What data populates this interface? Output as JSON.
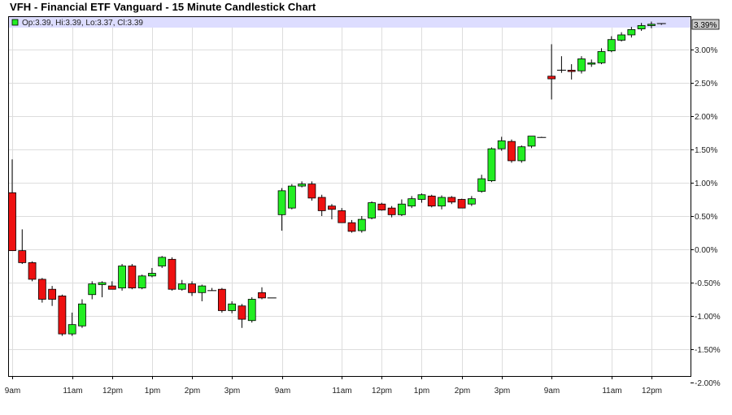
{
  "title": "VFH - Financial ETF Vanguard - 15 Minute Candlestick Chart",
  "legend": "Op:3.39, Hi:3.39, Lo:3.37, Cl:3.39",
  "last_value_label": "3.39%",
  "colors": {
    "up": "#22ee22",
    "down": "#ee1111",
    "grid": "#dddddd",
    "legend_band": "#ddddff",
    "last_label_bg": "#cccccc"
  },
  "chart_data": {
    "type": "candlestick",
    "ylim": [
      -2.0,
      3.5
    ],
    "y_ticks": [
      "-2.00%",
      "-1.50%",
      "-1.00%",
      "-0.50%",
      "0.00%",
      "0.50%",
      "1.00%",
      "1.50%",
      "2.00%",
      "2.50%",
      "3.00%"
    ],
    "y_tick_values": [
      -2.0,
      -1.5,
      -1.0,
      -0.5,
      0.0,
      0.5,
      1.0,
      1.5,
      2.0,
      2.5,
      3.0
    ],
    "x_labels": [
      {
        "label": "9am",
        "index": 0
      },
      {
        "label": "11am",
        "index": 6
      },
      {
        "label": "12pm",
        "index": 10
      },
      {
        "label": "1pm",
        "index": 14
      },
      {
        "label": "2pm",
        "index": 18
      },
      {
        "label": "3pm",
        "index": 22
      },
      {
        "label": "9am",
        "index": 27
      },
      {
        "label": "11am",
        "index": 33
      },
      {
        "label": "12pm",
        "index": 37
      },
      {
        "label": "1pm",
        "index": 41
      },
      {
        "label": "2pm",
        "index": 45
      },
      {
        "label": "3pm",
        "index": 49
      },
      {
        "label": "9am",
        "index": 54
      },
      {
        "label": "11am",
        "index": 60
      },
      {
        "label": "12pm",
        "index": 64
      }
    ],
    "candles": [
      [
        0.85,
        -0.02,
        1.35,
        -0.02
      ],
      [
        -0.02,
        -0.2,
        0.3,
        -0.22
      ],
      [
        -0.2,
        -0.45,
        -0.18,
        -0.48
      ],
      [
        -0.45,
        -0.75,
        -0.43,
        -0.8
      ],
      [
        -0.6,
        -0.75,
        -0.55,
        -0.85
      ],
      [
        -0.7,
        -1.27,
        -0.68,
        -1.3
      ],
      [
        -1.27,
        -1.13,
        -0.95,
        -1.3
      ],
      [
        -1.15,
        -0.82,
        -0.75,
        -1.18
      ],
      [
        -0.68,
        -0.52,
        -0.48,
        -0.75
      ],
      [
        -0.53,
        -0.5,
        -0.48,
        -0.72
      ],
      [
        -0.55,
        -0.6,
        -0.48,
        -0.6
      ],
      [
        -0.58,
        -0.25,
        -0.22,
        -0.62
      ],
      [
        -0.25,
        -0.58,
        -0.22,
        -0.6
      ],
      [
        -0.58,
        -0.4,
        -0.38,
        -0.6
      ],
      [
        -0.4,
        -0.36,
        -0.28,
        -0.42
      ],
      [
        -0.25,
        -0.12,
        -0.1,
        -0.28
      ],
      [
        -0.15,
        -0.6,
        -0.12,
        -0.62
      ],
      [
        -0.6,
        -0.52,
        -0.46,
        -0.62
      ],
      [
        -0.52,
        -0.65,
        -0.48,
        -0.7
      ],
      [
        -0.65,
        -0.55,
        -0.53,
        -0.78
      ],
      [
        -0.62,
        -0.62,
        -0.58,
        -0.62
      ],
      [
        -0.6,
        -0.92,
        -0.58,
        -0.95
      ],
      [
        -0.92,
        -0.82,
        -0.78,
        -0.96
      ],
      [
        -0.85,
        -1.05,
        -0.82,
        -1.18
      ],
      [
        -1.07,
        -0.75,
        -0.72,
        -1.1
      ],
      [
        -0.65,
        -0.73,
        -0.57,
        -0.75
      ],
      [
        -0.73,
        -0.73,
        -0.73,
        -0.73
      ],
      [
        0.52,
        0.88,
        0.92,
        0.28
      ],
      [
        0.62,
        0.95,
        0.98,
        0.6
      ],
      [
        0.95,
        0.98,
        1.02,
        0.93
      ],
      [
        0.98,
        0.77,
        1.02,
        0.73
      ],
      [
        0.78,
        0.58,
        0.82,
        0.5
      ],
      [
        0.65,
        0.6,
        0.68,
        0.45
      ],
      [
        0.58,
        0.4,
        0.62,
        0.4
      ],
      [
        0.4,
        0.27,
        0.44,
        0.25
      ],
      [
        0.28,
        0.45,
        0.5,
        0.25
      ],
      [
        0.47,
        0.7,
        0.72,
        0.45
      ],
      [
        0.68,
        0.59,
        0.7,
        0.58
      ],
      [
        0.62,
        0.52,
        0.65,
        0.48
      ],
      [
        0.52,
        0.68,
        0.75,
        0.5
      ],
      [
        0.65,
        0.76,
        0.8,
        0.62
      ],
      [
        0.75,
        0.82,
        0.84,
        0.7
      ],
      [
        0.8,
        0.65,
        0.82,
        0.63
      ],
      [
        0.65,
        0.78,
        0.81,
        0.6
      ],
      [
        0.78,
        0.71,
        0.8,
        0.68
      ],
      [
        0.75,
        0.62,
        0.76,
        0.62
      ],
      [
        0.68,
        0.76,
        0.8,
        0.65
      ],
      [
        0.87,
        1.06,
        1.12,
        0.85
      ],
      [
        1.03,
        1.51,
        1.53,
        1.01
      ],
      [
        1.51,
        1.63,
        1.69,
        1.48
      ],
      [
        1.62,
        1.33,
        1.65,
        1.3
      ],
      [
        1.33,
        1.54,
        1.56,
        1.3
      ],
      [
        1.55,
        1.7,
        1.7,
        1.52
      ],
      [
        1.68,
        1.68,
        1.69,
        1.68
      ],
      [
        2.6,
        2.56,
        3.08,
        2.25
      ],
      [
        2.69,
        2.69,
        2.9,
        2.65
      ],
      [
        2.69,
        2.67,
        2.78,
        2.55
      ],
      [
        2.68,
        2.86,
        2.9,
        2.64
      ],
      [
        2.78,
        2.8,
        2.85,
        2.74
      ],
      [
        2.8,
        2.97,
        3.02,
        2.78
      ],
      [
        2.98,
        3.15,
        3.2,
        2.96
      ],
      [
        3.14,
        3.22,
        3.26,
        3.12
      ],
      [
        3.22,
        3.3,
        3.34,
        3.18
      ],
      [
        3.31,
        3.36,
        3.4,
        3.28
      ],
      [
        3.36,
        3.38,
        3.42,
        3.32
      ],
      [
        3.39,
        3.39,
        3.39,
        3.37
      ]
    ]
  }
}
